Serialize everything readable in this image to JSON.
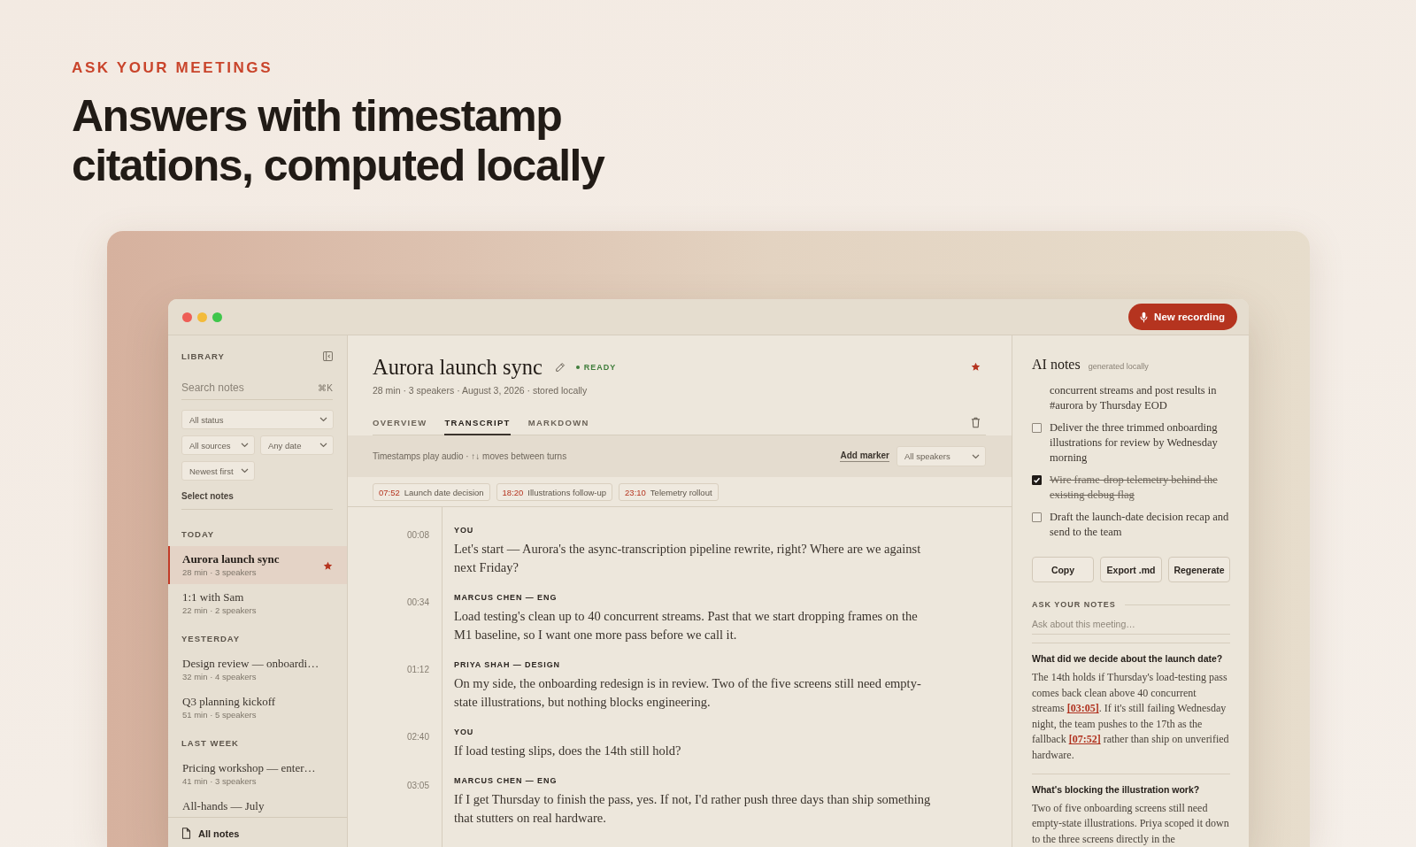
{
  "hero": {
    "eyebrow": "ASK YOUR MEETINGS",
    "headline": "Answers with timestamp citations, computed locally"
  },
  "window": {
    "record_button": "New recording"
  },
  "sidebar": {
    "title": "LIBRARY",
    "search": {
      "placeholder": "Search notes",
      "shortcut": "⌘K"
    },
    "filters": [
      {
        "value": "All status"
      },
      {
        "value": "All sources"
      },
      {
        "value": "Any date"
      },
      {
        "value": "Newest first"
      }
    ],
    "select_link": "Select notes",
    "groups": [
      {
        "label": "TODAY",
        "items": [
          {
            "title": "Aurora launch sync",
            "meta": "28 min · 3 speakers",
            "selected": true,
            "starred": true
          },
          {
            "title": "1:1 with Sam",
            "meta": "22 min · 2 speakers",
            "selected": false,
            "starred": false
          }
        ]
      },
      {
        "label": "YESTERDAY",
        "items": [
          {
            "title": "Design review — onboardi…",
            "meta": "32 min · 4 speakers",
            "selected": false,
            "starred": false
          },
          {
            "title": "Q3 planning kickoff",
            "meta": "51 min · 5 speakers",
            "selected": false,
            "starred": false
          }
        ]
      },
      {
        "label": "LAST WEEK",
        "items": [
          {
            "title": "Pricing workshop — enter…",
            "meta": "41 min · 3 speakers",
            "selected": false,
            "starred": false
          },
          {
            "title": "All-hands — July",
            "selected": false,
            "starred": false
          }
        ]
      }
    ],
    "footer_link": "All notes"
  },
  "note": {
    "title": "Aurora launch sync",
    "status": "READY",
    "starred": true,
    "meta": "28 min · 3 speakers · August 3, 2026 · stored locally",
    "tabs": [
      {
        "label": "OVERVIEW",
        "selected": false
      },
      {
        "label": "TRANSCRIPT",
        "selected": true
      },
      {
        "label": "MARKDOWN",
        "selected": false
      }
    ],
    "toolbar": {
      "hint": "Timestamps play audio · ↑↓ moves between turns",
      "add_marker": "Add marker",
      "speaker_filter": "All speakers"
    },
    "markers": [
      {
        "time": "07:52",
        "label": "Launch date decision"
      },
      {
        "time": "18:20",
        "label": "Illustrations follow-up"
      },
      {
        "time": "23:10",
        "label": "Telemetry rollout"
      }
    ],
    "transcript": [
      {
        "time": "00:08",
        "speaker": "YOU",
        "text": "Let's start — Aurora's the async-transcription pipeline rewrite, right? Where are we against next Friday?"
      },
      {
        "time": "00:34",
        "speaker": "MARCUS CHEN — ENG",
        "text": "Load testing's clean up to 40 concurrent streams. Past that we start dropping frames on the M1 baseline, so I want one more pass before we call it."
      },
      {
        "time": "01:12",
        "speaker": "PRIYA SHAH — DESIGN",
        "text": "On my side, the onboarding redesign is in review. Two of the five screens still need empty-state illustrations, but nothing blocks engineering."
      },
      {
        "time": "02:40",
        "speaker": "YOU",
        "text": "If load testing slips, does the 14th still hold?"
      },
      {
        "time": "03:05",
        "speaker": "MARCUS CHEN — ENG",
        "text": "If I get Thursday to finish the pass, yes. If not, I'd rather push three days than ship something that stutters on real hardware."
      }
    ]
  },
  "ai_notes": {
    "title": "AI notes",
    "subtitle": "generated locally",
    "partial_item_text": "concurrent streams and post results in #aurora by Thursday EOD",
    "items": [
      {
        "text": "Deliver the three trimmed onboarding illustrations for review by Wednesday morning",
        "checked": false
      },
      {
        "text": "Wire frame-drop telemetry behind the existing debug flag",
        "checked": true
      },
      {
        "text": "Draft the launch-date decision recap and send to the team",
        "checked": false
      }
    ],
    "buttons": [
      "Copy",
      "Export .md",
      "Regenerate"
    ],
    "ask": {
      "label": "ASK YOUR NOTES",
      "placeholder": "Ask about this meeting…"
    },
    "answers": [
      {
        "question": "What did we decide about the launch date?",
        "parts": [
          {
            "kind": "text",
            "text": "The 14th holds if Thursday's load-testing pass comes back clean above 40 concurrent streams "
          },
          {
            "kind": "cite",
            "text": "[03:05]"
          },
          {
            "kind": "text",
            "text": ". If it's still failing Wednesday night, the team pushes to the 17th as the fallback "
          },
          {
            "kind": "cite",
            "text": "[07:52]"
          },
          {
            "kind": "text",
            "text": " rather than ship on unverified hardware."
          }
        ]
      },
      {
        "question": "What's blocking the illustration work?",
        "parts": [
          {
            "kind": "text",
            "text": "Two of five onboarding screens still need empty-state illustrations. Priya scoped it down to the three screens directly in the"
          }
        ]
      }
    ]
  }
}
